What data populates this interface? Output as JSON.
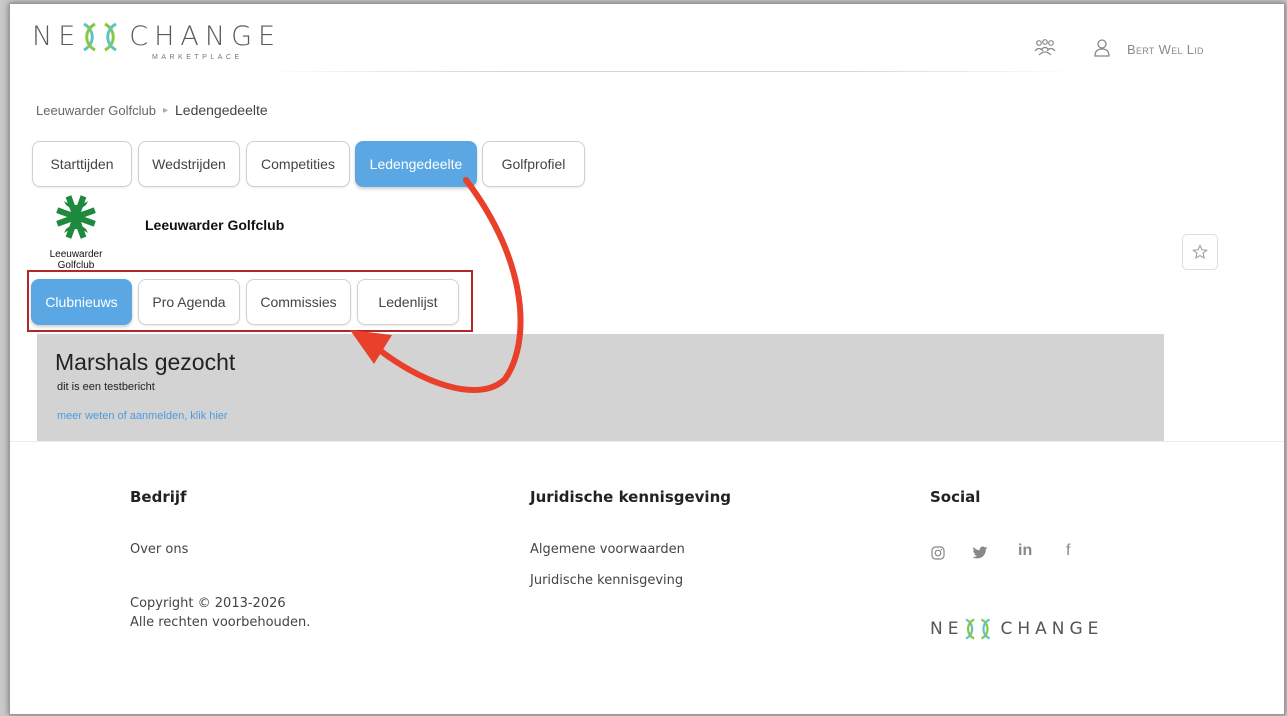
{
  "header": {
    "logo_left": "NE",
    "logo_right": "CHANGE",
    "logo_sub": "MARKETPLACE",
    "user_name": "Bert Wel Lid"
  },
  "breadcrumb": {
    "parent": "Leeuwarder Golfclub",
    "separator": "▸",
    "current": "Ledengedeelte"
  },
  "main_tabs": [
    {
      "label": "Starttijden",
      "active": false
    },
    {
      "label": "Wedstrijden",
      "active": false
    },
    {
      "label": "Competities",
      "active": false
    },
    {
      "label": "Ledengedeelte",
      "active": true
    },
    {
      "label": "Golfprofiel",
      "active": false
    }
  ],
  "club": {
    "logo_line1": "Leeuwarder",
    "logo_line2": "Golfclub",
    "name": "Leeuwarder Golfclub"
  },
  "sub_tabs": [
    {
      "label": "Clubnieuws",
      "active": true
    },
    {
      "label": "Pro Agenda",
      "active": false
    },
    {
      "label": "Commissies",
      "active": false
    },
    {
      "label": "Ledenlijst",
      "active": false
    }
  ],
  "news": {
    "title": "Marshals gezocht",
    "body": "dit is een testbericht",
    "link": "meer weten of aanmelden, klik hier"
  },
  "footer": {
    "company": {
      "heading": "Bedrijf",
      "link": "Over ons",
      "copyright_line1": "Copyright © 2013-2026",
      "copyright_line2": "Alle rechten voorbehouden."
    },
    "legal": {
      "heading": "Juridische kennisgeving",
      "link1": "Algemene voorwaarden",
      "link2": "Juridische kennisgeving"
    },
    "social": {
      "heading": "Social",
      "icons": [
        "instagram-icon",
        "twitter-icon",
        "linkedin-icon",
        "facebook-icon"
      ],
      "linkedin_text": "in",
      "facebook_text": "f"
    },
    "logo_left": "NE",
    "logo_right": "CHANGE"
  },
  "colors": {
    "accent": "#5aa7e3",
    "highlight": "#b3262c",
    "arrow": "#e8402a",
    "news_bg": "#d3d3d3",
    "club_green": "#1e8a3e",
    "logo_teal": "#5bc6c0",
    "logo_green": "#8cc63f"
  }
}
